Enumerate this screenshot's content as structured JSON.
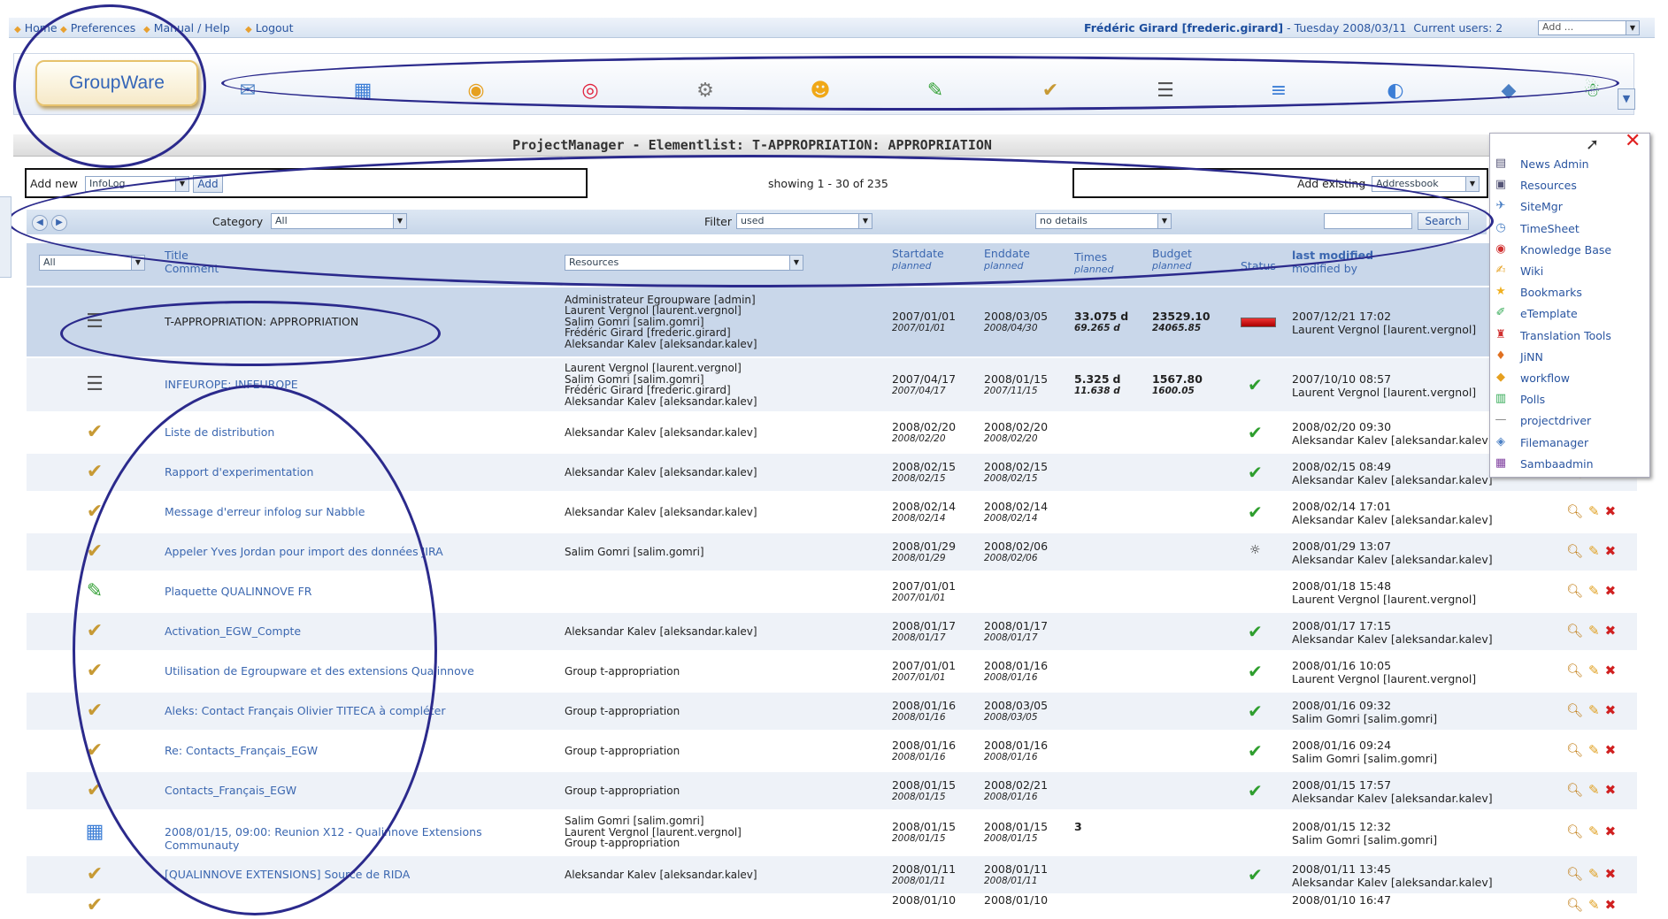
{
  "topbar": {
    "home": "Home",
    "preferences": "Preferences",
    "manual": "Manual / Help",
    "logout": "Logout",
    "user": "Frédéric Girard [frederic.girard]",
    "date": " - Tuesday 2008/03/11",
    "current_users": "Current users: 2",
    "add_select": "Add ..."
  },
  "logo": "GroupWare",
  "apps": [
    {
      "name": "email-icon",
      "glyph": "✉",
      "color": "#4a7fc4"
    },
    {
      "name": "calendar-icon",
      "glyph": "▦",
      "color": "#3c7ed6"
    },
    {
      "name": "addressbook-icon",
      "glyph": "◉",
      "color": "#e6a020"
    },
    {
      "name": "target-icon",
      "glyph": "◎",
      "color": "#e0203a"
    },
    {
      "name": "gear-icon",
      "glyph": "⚙",
      "color": "#777"
    },
    {
      "name": "admin-icon",
      "glyph": "☻",
      "color": "#f0a818"
    },
    {
      "name": "projects-icon",
      "glyph": "✎",
      "color": "#33a035"
    },
    {
      "name": "infolog-icon",
      "glyph": "✔",
      "color": "#c79a35"
    },
    {
      "name": "projectmanager-icon",
      "glyph": "☰",
      "color": "#555"
    },
    {
      "name": "tracker-icon",
      "glyph": "≡",
      "color": "#3c7ed6"
    },
    {
      "name": "browser-icon",
      "glyph": "◐",
      "color": "#3c7ed6"
    },
    {
      "name": "wiki-icon",
      "glyph": "◆",
      "color": "#4a7fc4"
    },
    {
      "name": "users-icon",
      "glyph": "☃",
      "color": "#2f9e44"
    }
  ],
  "page": {
    "title": "ProjectManager - Elementlist: T-APPROPRIATION: APPROPRIATION",
    "add_new": "Add new",
    "add_new_select": "InfoLog",
    "add_btn": "Add",
    "showing": "showing 1 - 30 of 235",
    "add_existing": "Add existing",
    "add_existing_select": "Addressbook",
    "category_label": "Category",
    "category_value": "All",
    "filter_label": "Filter",
    "filter_value": "used",
    "details_value": "no details",
    "search_btn": "Search",
    "all_select": "All"
  },
  "columns": {
    "title": "Title",
    "comment": "Comment",
    "resources": "Resources",
    "startdate": "Startdate",
    "enddate": "Enddate",
    "times": "Times",
    "budget": "Budget",
    "planned": "planned",
    "status": "Status",
    "lastmod": "last modified",
    "modby": "modified by"
  },
  "rows": [
    {
      "icon": "projectmanager-icon",
      "glyph": "☰",
      "color": "#555",
      "title": "T-APPROPRIATION: APPROPRIATION",
      "resources": [
        "Administrateur Egroupware [admin]",
        "Laurent Vergnol [laurent.vergnol]",
        "Salim Gomri [salim.gomri]",
        "Frédéric Girard [frederic.girard]",
        "Aleksandar Kalev [aleksandar.kalev]"
      ],
      "start": "2007/01/01",
      "start_p": "2007/01/01",
      "end": "2008/03/05",
      "end_p": "2008/04/30",
      "times": "33.075",
      "times_p": "69.265",
      "times_unit": "d",
      "budget": "23529.10",
      "budget_p": "24065.85",
      "status": "bar",
      "mod": "2007/12/21 17:02",
      "modby": "Laurent Vergnol [laurent.vergnol]",
      "highlight": true
    },
    {
      "icon": "projectmanager-icon",
      "glyph": "☰",
      "color": "#555",
      "title": "INFEUROPE: INFEUROPE",
      "resources": [
        "Laurent Vergnol [laurent.vergnol]",
        "Salim Gomri [salim.gomri]",
        "Frédéric Girard [frederic.girard]",
        "Aleksandar Kalev [aleksandar.kalev]"
      ],
      "start": "2007/04/17",
      "start_p": "2007/04/17",
      "end": "2008/01/15",
      "end_p": "2007/11/15",
      "times": "5.325",
      "times_p": "11.638",
      "times_unit": "d",
      "budget": "1567.80",
      "budget_p": "1600.05",
      "status": "check",
      "mod": "2007/10/10 08:57",
      "modby": "Laurent Vergnol [laurent.vergnol]"
    },
    {
      "icon": "infolog-icon",
      "glyph": "✔",
      "color": "#c79a35",
      "title": "Liste de distribution",
      "resources": [
        "Aleksandar Kalev [aleksandar.kalev]"
      ],
      "start": "2008/02/20",
      "start_p": "2008/02/20",
      "end": "2008/02/20",
      "end_p": "2008/02/20",
      "status": "check",
      "mod": "2008/02/20 09:30",
      "modby": "Aleksandar Kalev [aleksandar.kalev]"
    },
    {
      "icon": "infolog-icon",
      "glyph": "✔",
      "color": "#c79a35",
      "title": "Rapport d'experimentation",
      "resources": [
        "Aleksandar Kalev [aleksandar.kalev]"
      ],
      "start": "2008/02/15",
      "start_p": "2008/02/15",
      "end": "2008/02/15",
      "end_p": "2008/02/15",
      "status": "check",
      "mod": "2008/02/15 08:49",
      "modby": "Aleksandar Kalev [aleksandar.kalev]"
    },
    {
      "icon": "infolog-icon",
      "glyph": "✔",
      "color": "#c79a35",
      "title": "Message d'erreur infolog sur Nabble",
      "resources": [
        "Aleksandar Kalev [aleksandar.kalev]"
      ],
      "start": "2008/02/14",
      "start_p": "2008/02/14",
      "end": "2008/02/14",
      "end_p": "2008/02/14",
      "status": "check",
      "mod": "2008/02/14 17:01",
      "modby": "Aleksandar Kalev [aleksandar.kalev]"
    },
    {
      "icon": "infolog-icon",
      "glyph": "✔",
      "color": "#c79a35",
      "title": "Appeler Yves Jordan pour import des données JIRA",
      "resources": [
        "Salim Gomri [salim.gomri]"
      ],
      "start": "2008/01/29",
      "start_p": "2008/01/29",
      "end": "2008/02/06",
      "end_p": "2008/02/06",
      "status": "busy",
      "mod": "2008/01/29 13:07",
      "modby": "Aleksandar Kalev [aleksandar.kalev]"
    },
    {
      "icon": "projects-icon",
      "glyph": "✎",
      "color": "#33a035",
      "title": "Plaquette QUALINNOVE FR",
      "resources": [],
      "start": "2007/01/01",
      "start_p": "2007/01/01",
      "end": "",
      "end_p": "",
      "status": "",
      "mod": "2008/01/18 15:48",
      "modby": "Laurent Vergnol [laurent.vergnol]"
    },
    {
      "icon": "infolog-icon",
      "glyph": "✔",
      "color": "#c79a35",
      "title": "Activation_EGW_Compte",
      "resources": [
        "Aleksandar Kalev [aleksandar.kalev]"
      ],
      "start": "2008/01/17",
      "start_p": "2008/01/17",
      "end": "2008/01/17",
      "end_p": "2008/01/17",
      "status": "check",
      "mod": "2008/01/17 17:15",
      "modby": "Aleksandar Kalev [aleksandar.kalev]"
    },
    {
      "icon": "infolog-icon",
      "glyph": "✔",
      "color": "#c79a35",
      "title": "Utilisation de Egroupware et des extensions Qualinnove",
      "resources": [
        "Group t-appropriation"
      ],
      "start": "2007/01/01",
      "start_p": "2007/01/01",
      "end": "2008/01/16",
      "end_p": "2008/01/16",
      "status": "check",
      "mod": "2008/01/16 10:05",
      "modby": "Laurent Vergnol [laurent.vergnol]"
    },
    {
      "icon": "infolog-icon",
      "glyph": "✔",
      "color": "#c79a35",
      "title": "Aleks: Contact Français Olivier TITECA à compléter",
      "resources": [
        "Group t-appropriation"
      ],
      "start": "2008/01/16",
      "start_p": "2008/01/16",
      "end": "2008/03/05",
      "end_p": "2008/03/05",
      "status": "check",
      "mod": "2008/01/16 09:32",
      "modby": "Salim Gomri [salim.gomri]"
    },
    {
      "icon": "infolog-icon",
      "glyph": "✔",
      "color": "#c79a35",
      "title": "Re: Contacts_Français_EGW",
      "resources": [
        "Group t-appropriation"
      ],
      "start": "2008/01/16",
      "start_p": "2008/01/16",
      "end": "2008/01/16",
      "end_p": "2008/01/16",
      "status": "check",
      "mod": "2008/01/16 09:24",
      "modby": "Salim Gomri [salim.gomri]"
    },
    {
      "icon": "infolog-icon",
      "glyph": "✔",
      "color": "#c79a35",
      "title": "Contacts_Français_EGW",
      "resources": [
        "Group t-appropriation"
      ],
      "start": "2008/01/15",
      "start_p": "2008/01/15",
      "end": "2008/02/21",
      "end_p": "2008/01/16",
      "status": "check",
      "mod": "2008/01/15 17:57",
      "modby": "Aleksandar Kalev [aleksandar.kalev]"
    },
    {
      "icon": "calendar-icon",
      "glyph": "▦",
      "color": "#3c7ed6",
      "title": "2008/01/15, 09:00: Reunion X12 - Qualinnove Extensions Communauty",
      "resources": [
        "Salim Gomri [salim.gomri]",
        "Laurent Vergnol [laurent.vergnol]",
        "Group t-appropriation"
      ],
      "start": "2008/01/15",
      "start_p": "2008/01/15",
      "end": "2008/01/15",
      "end_p": "2008/01/15",
      "times": "3",
      "status": "",
      "mod": "2008/01/15 12:32",
      "modby": "Salim Gomri [salim.gomri]"
    },
    {
      "icon": "infolog-icon",
      "glyph": "✔",
      "color": "#c79a35",
      "title": "[QUALINNOVE EXTENSIONS] Source de RIDA",
      "resources": [
        "Aleksandar Kalev [aleksandar.kalev]"
      ],
      "start": "2008/01/11",
      "start_p": "2008/01/11",
      "end": "2008/01/11",
      "end_p": "2008/01/11",
      "status": "check",
      "mod": "2008/01/11 13:45",
      "modby": "Aleksandar Kalev [aleksandar.kalev]"
    },
    {
      "icon": "infolog-icon",
      "glyph": "✔",
      "color": "#c79a35",
      "title": "",
      "resources": [],
      "start": "2008/01/10",
      "start_p": "",
      "end": "2008/01/10",
      "end_p": "",
      "status": "",
      "mod": "2008/01/10 16:47",
      "modby": ""
    }
  ],
  "dropdown": [
    {
      "label": "News Admin",
      "glyph": "▤",
      "color": "#557"
    },
    {
      "label": "Resources",
      "glyph": "▣",
      "color": "#557"
    },
    {
      "label": "SiteMgr",
      "glyph": "✈",
      "color": "#4a7fc4"
    },
    {
      "label": "TimeSheet",
      "glyph": "◷",
      "color": "#4a7fc4"
    },
    {
      "label": "Knowledge Base",
      "glyph": "◉",
      "color": "#d03030"
    },
    {
      "label": "Wiki",
      "glyph": "✍",
      "color": "#e6a020"
    },
    {
      "label": "Bookmarks",
      "glyph": "★",
      "color": "#f0b020"
    },
    {
      "label": "eTemplate",
      "glyph": "✐",
      "color": "#3a5"
    },
    {
      "label": "Translation Tools",
      "glyph": "♜",
      "color": "#d03030"
    },
    {
      "label": "JiNN",
      "glyph": "♦",
      "color": "#e07020"
    },
    {
      "label": "workflow",
      "glyph": "◆",
      "color": "#e6a020"
    },
    {
      "label": "Polls",
      "glyph": "▥",
      "color": "#3a5"
    },
    {
      "label": "projectdriver",
      "glyph": "—",
      "color": "#888"
    },
    {
      "label": "Filemanager",
      "glyph": "◈",
      "color": "#4a7fc4"
    },
    {
      "label": "Sambaadmin",
      "glyph": "▦",
      "color": "#8040a0"
    }
  ]
}
